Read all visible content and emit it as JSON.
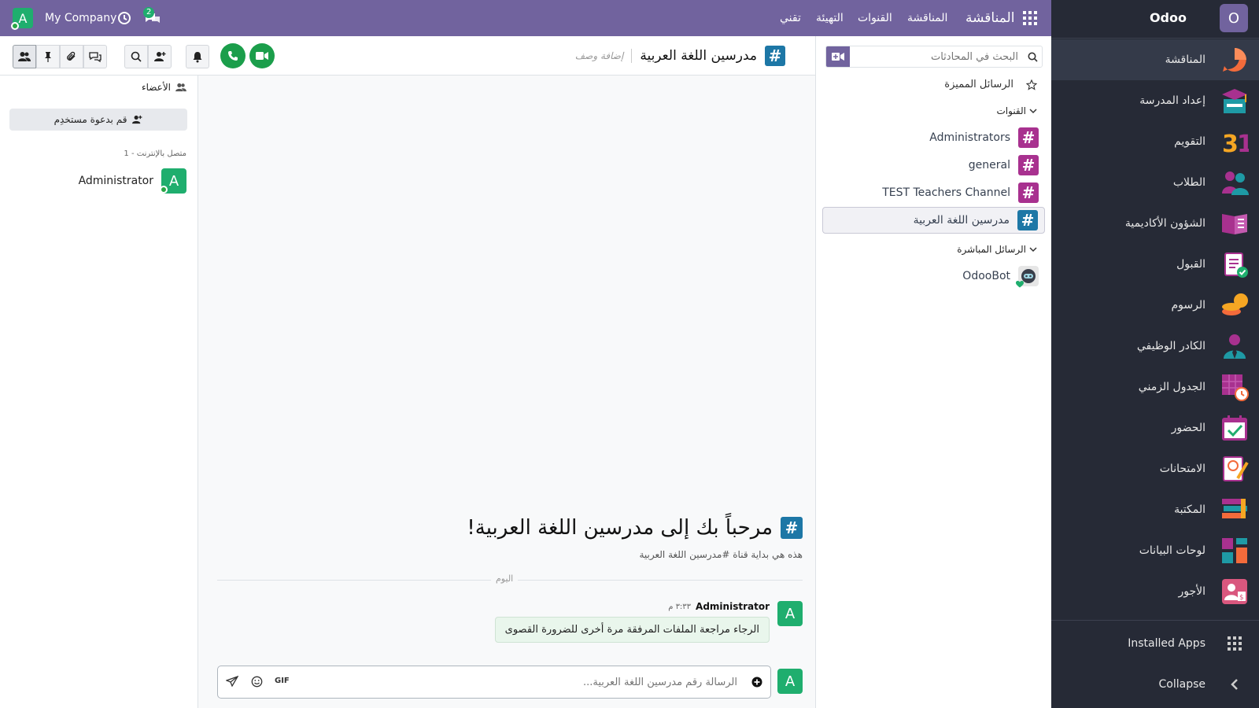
{
  "topbar": {
    "apps_title": "المناقشة",
    "menu": [
      "المناقشة",
      "القنوات",
      "التهيئة",
      "تقني"
    ],
    "company": "My Company",
    "avatar_letter": "A",
    "messages_badge": "2"
  },
  "sidebar": {
    "brand": "Odoo",
    "brand_letter": "O",
    "items": [
      {
        "label": "المناقشة",
        "icon": "discuss-icon"
      },
      {
        "label": "إعداد المدرسة",
        "icon": "school-setup-icon"
      },
      {
        "label": "التقويم",
        "icon": "calendar-icon"
      },
      {
        "label": "الطلاب",
        "icon": "students-icon"
      },
      {
        "label": "الشؤون الأكاديمية",
        "icon": "academic-book-icon"
      },
      {
        "label": "القبول",
        "icon": "admission-icon"
      },
      {
        "label": "الرسوم",
        "icon": "fees-icon"
      },
      {
        "label": "الكادر الوظيفي",
        "icon": "staff-icon"
      },
      {
        "label": "الجدول الزمني",
        "icon": "timetable-icon"
      },
      {
        "label": "الحضور",
        "icon": "attendance-icon"
      },
      {
        "label": "الامتحانات",
        "icon": "exams-icon"
      },
      {
        "label": "المكتبة",
        "icon": "library-icon"
      },
      {
        "label": "لوحات البيانات",
        "icon": "dashboards-icon"
      },
      {
        "label": "الأجور",
        "icon": "payroll-icon"
      }
    ],
    "installed_apps": "Installed Apps",
    "collapse": "Collapse",
    "colors": {
      "bg": "#262a36",
      "active": "#343a49"
    }
  },
  "channels_panel": {
    "search_placeholder": "البحث في المحادثات",
    "starred": "الرسائل المميزة",
    "channels_header": "القنوات",
    "channels": [
      {
        "name": "Administrators",
        "active": false
      },
      {
        "name": "general",
        "active": false
      },
      {
        "name": "TEST Teachers Channel",
        "active": false
      },
      {
        "name": "مدرسين اللغة العربية",
        "active": true
      }
    ],
    "dm_header": "الرسائل المباشرة",
    "direct_messages": [
      {
        "name": "OdooBot"
      }
    ]
  },
  "thread": {
    "channel_name": "مدرسين اللغة العربية",
    "add_description": "إضافة وصف",
    "welcome_title": "مرحباً بك إلى مدرسين اللغة العربية!",
    "welcome_sub": "هذه هي بداية قناة #مدرسين اللغة العربية",
    "day_separator": "اليوم",
    "message": {
      "author": "Administrator",
      "time": "٣:٣٣ م",
      "text": "الرجاء مراجعة الملفات المرفقة مرة أخرى للضرورة القصوى"
    },
    "composer_placeholder": "الرسالة رقم مدرسين اللغة العربية...",
    "gif_label": "GIF"
  },
  "members": {
    "title": "الأعضاء",
    "invite_button": "قم بدعوة مستخدِم",
    "online_header": "متصل بالإنترنت - 1",
    "list": [
      {
        "name": "Administrator",
        "letter": "A"
      }
    ]
  }
}
